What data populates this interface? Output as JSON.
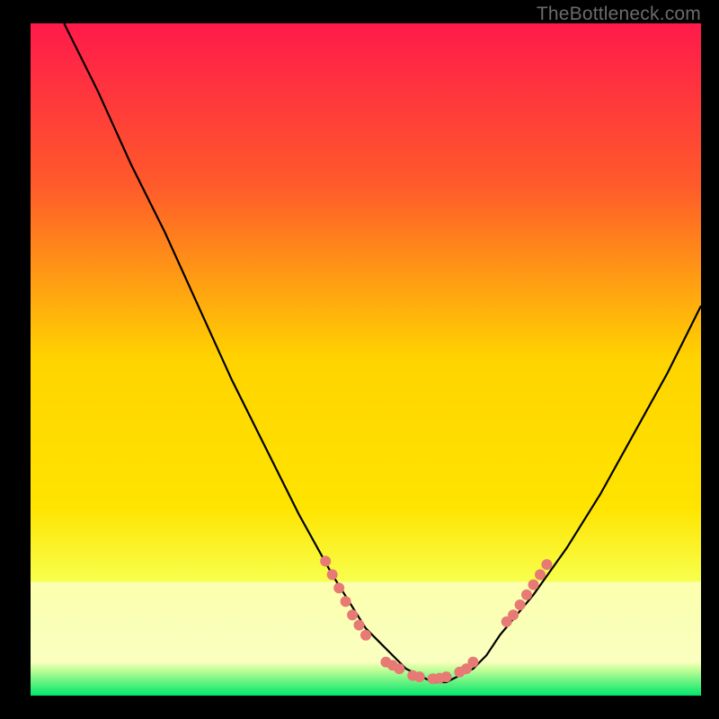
{
  "watermark": "TheBottleneck.com",
  "colors": {
    "bg": "#000000",
    "grad_top": "#ff1a4b",
    "grad_mid1": "#ff6a2a",
    "grad_mid2": "#ffd400",
    "grad_low": "#f7ff4d",
    "grad_band": "#fbffad",
    "grad_bottom": "#00e66a",
    "curve": "#000000",
    "marker": "#e77a74",
    "watermark": "#6b6b6b"
  },
  "chart_data": {
    "type": "line",
    "title": "",
    "xlabel": "",
    "ylabel": "",
    "xlim": [
      0,
      100
    ],
    "ylim": [
      0,
      100
    ],
    "series": [
      {
        "name": "bottleneck-curve",
        "x": [
          5,
          10,
          15,
          20,
          25,
          30,
          35,
          40,
          45,
          50,
          52,
          54,
          56,
          58,
          60,
          62,
          64,
          66,
          68,
          70,
          75,
          80,
          85,
          90,
          95,
          100
        ],
        "y": [
          100,
          90,
          79,
          69,
          58,
          47,
          37,
          27,
          18,
          10,
          8,
          6,
          4,
          3,
          2,
          2,
          3,
          4,
          6,
          9,
          15,
          22,
          30,
          39,
          48,
          58
        ]
      }
    ],
    "markers": [
      {
        "x": 44,
        "y": 20
      },
      {
        "x": 45,
        "y": 18
      },
      {
        "x": 46,
        "y": 16
      },
      {
        "x": 47,
        "y": 14
      },
      {
        "x": 48,
        "y": 12
      },
      {
        "x": 49,
        "y": 10.5
      },
      {
        "x": 50,
        "y": 9
      },
      {
        "x": 53,
        "y": 5
      },
      {
        "x": 54,
        "y": 4.5
      },
      {
        "x": 55,
        "y": 4
      },
      {
        "x": 57,
        "y": 3
      },
      {
        "x": 58,
        "y": 2.8
      },
      {
        "x": 60,
        "y": 2.5
      },
      {
        "x": 61,
        "y": 2.6
      },
      {
        "x": 62,
        "y": 2.8
      },
      {
        "x": 64,
        "y": 3.5
      },
      {
        "x": 65,
        "y": 4
      },
      {
        "x": 66,
        "y": 5
      },
      {
        "x": 71,
        "y": 11
      },
      {
        "x": 72,
        "y": 12
      },
      {
        "x": 73,
        "y": 13.5
      },
      {
        "x": 74,
        "y": 15
      },
      {
        "x": 75,
        "y": 16.5
      },
      {
        "x": 76,
        "y": 18
      },
      {
        "x": 77,
        "y": 19.5
      }
    ]
  }
}
